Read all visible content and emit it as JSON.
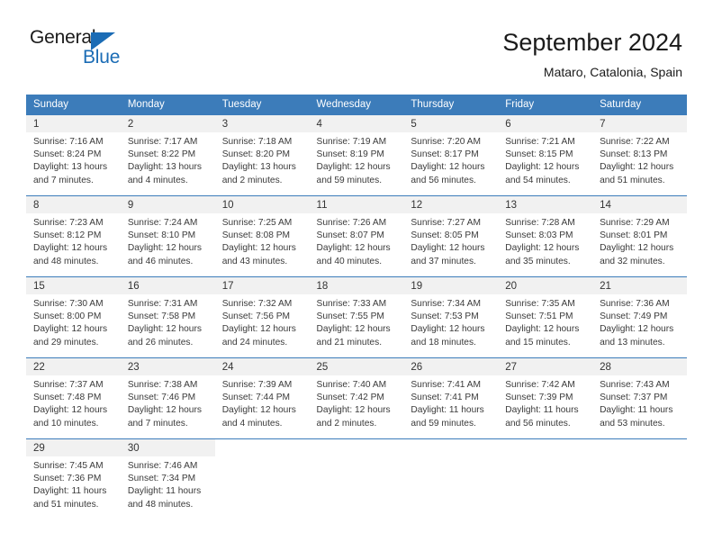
{
  "brand": {
    "name_top": "General",
    "name_bottom": "Blue",
    "accent_color": "#1b6cb5",
    "triangle_icon": "brand-triangle-icon"
  },
  "header": {
    "title": "September 2024",
    "subtitle": "Mataro, Catalonia, Spain"
  },
  "calendar": {
    "header_bg": "#3c7cba",
    "header_text_color": "#ffffff",
    "daynum_bg": "#f1f1f1",
    "weekday_headers": [
      "Sunday",
      "Monday",
      "Tuesday",
      "Wednesday",
      "Thursday",
      "Friday",
      "Saturday"
    ],
    "weeks": [
      [
        {
          "day": "1",
          "sunrise": "Sunrise: 7:16 AM",
          "sunset": "Sunset: 8:24 PM",
          "daylight_1": "Daylight: 13 hours",
          "daylight_2": "and 7 minutes."
        },
        {
          "day": "2",
          "sunrise": "Sunrise: 7:17 AM",
          "sunset": "Sunset: 8:22 PM",
          "daylight_1": "Daylight: 13 hours",
          "daylight_2": "and 4 minutes."
        },
        {
          "day": "3",
          "sunrise": "Sunrise: 7:18 AM",
          "sunset": "Sunset: 8:20 PM",
          "daylight_1": "Daylight: 13 hours",
          "daylight_2": "and 2 minutes."
        },
        {
          "day": "4",
          "sunrise": "Sunrise: 7:19 AM",
          "sunset": "Sunset: 8:19 PM",
          "daylight_1": "Daylight: 12 hours",
          "daylight_2": "and 59 minutes."
        },
        {
          "day": "5",
          "sunrise": "Sunrise: 7:20 AM",
          "sunset": "Sunset: 8:17 PM",
          "daylight_1": "Daylight: 12 hours",
          "daylight_2": "and 56 minutes."
        },
        {
          "day": "6",
          "sunrise": "Sunrise: 7:21 AM",
          "sunset": "Sunset: 8:15 PM",
          "daylight_1": "Daylight: 12 hours",
          "daylight_2": "and 54 minutes."
        },
        {
          "day": "7",
          "sunrise": "Sunrise: 7:22 AM",
          "sunset": "Sunset: 8:13 PM",
          "daylight_1": "Daylight: 12 hours",
          "daylight_2": "and 51 minutes."
        }
      ],
      [
        {
          "day": "8",
          "sunrise": "Sunrise: 7:23 AM",
          "sunset": "Sunset: 8:12 PM",
          "daylight_1": "Daylight: 12 hours",
          "daylight_2": "and 48 minutes."
        },
        {
          "day": "9",
          "sunrise": "Sunrise: 7:24 AM",
          "sunset": "Sunset: 8:10 PM",
          "daylight_1": "Daylight: 12 hours",
          "daylight_2": "and 46 minutes."
        },
        {
          "day": "10",
          "sunrise": "Sunrise: 7:25 AM",
          "sunset": "Sunset: 8:08 PM",
          "daylight_1": "Daylight: 12 hours",
          "daylight_2": "and 43 minutes."
        },
        {
          "day": "11",
          "sunrise": "Sunrise: 7:26 AM",
          "sunset": "Sunset: 8:07 PM",
          "daylight_1": "Daylight: 12 hours",
          "daylight_2": "and 40 minutes."
        },
        {
          "day": "12",
          "sunrise": "Sunrise: 7:27 AM",
          "sunset": "Sunset: 8:05 PM",
          "daylight_1": "Daylight: 12 hours",
          "daylight_2": "and 37 minutes."
        },
        {
          "day": "13",
          "sunrise": "Sunrise: 7:28 AM",
          "sunset": "Sunset: 8:03 PM",
          "daylight_1": "Daylight: 12 hours",
          "daylight_2": "and 35 minutes."
        },
        {
          "day": "14",
          "sunrise": "Sunrise: 7:29 AM",
          "sunset": "Sunset: 8:01 PM",
          "daylight_1": "Daylight: 12 hours",
          "daylight_2": "and 32 minutes."
        }
      ],
      [
        {
          "day": "15",
          "sunrise": "Sunrise: 7:30 AM",
          "sunset": "Sunset: 8:00 PM",
          "daylight_1": "Daylight: 12 hours",
          "daylight_2": "and 29 minutes."
        },
        {
          "day": "16",
          "sunrise": "Sunrise: 7:31 AM",
          "sunset": "Sunset: 7:58 PM",
          "daylight_1": "Daylight: 12 hours",
          "daylight_2": "and 26 minutes."
        },
        {
          "day": "17",
          "sunrise": "Sunrise: 7:32 AM",
          "sunset": "Sunset: 7:56 PM",
          "daylight_1": "Daylight: 12 hours",
          "daylight_2": "and 24 minutes."
        },
        {
          "day": "18",
          "sunrise": "Sunrise: 7:33 AM",
          "sunset": "Sunset: 7:55 PM",
          "daylight_1": "Daylight: 12 hours",
          "daylight_2": "and 21 minutes."
        },
        {
          "day": "19",
          "sunrise": "Sunrise: 7:34 AM",
          "sunset": "Sunset: 7:53 PM",
          "daylight_1": "Daylight: 12 hours",
          "daylight_2": "and 18 minutes."
        },
        {
          "day": "20",
          "sunrise": "Sunrise: 7:35 AM",
          "sunset": "Sunset: 7:51 PM",
          "daylight_1": "Daylight: 12 hours",
          "daylight_2": "and 15 minutes."
        },
        {
          "day": "21",
          "sunrise": "Sunrise: 7:36 AM",
          "sunset": "Sunset: 7:49 PM",
          "daylight_1": "Daylight: 12 hours",
          "daylight_2": "and 13 minutes."
        }
      ],
      [
        {
          "day": "22",
          "sunrise": "Sunrise: 7:37 AM",
          "sunset": "Sunset: 7:48 PM",
          "daylight_1": "Daylight: 12 hours",
          "daylight_2": "and 10 minutes."
        },
        {
          "day": "23",
          "sunrise": "Sunrise: 7:38 AM",
          "sunset": "Sunset: 7:46 PM",
          "daylight_1": "Daylight: 12 hours",
          "daylight_2": "and 7 minutes."
        },
        {
          "day": "24",
          "sunrise": "Sunrise: 7:39 AM",
          "sunset": "Sunset: 7:44 PM",
          "daylight_1": "Daylight: 12 hours",
          "daylight_2": "and 4 minutes."
        },
        {
          "day": "25",
          "sunrise": "Sunrise: 7:40 AM",
          "sunset": "Sunset: 7:42 PM",
          "daylight_1": "Daylight: 12 hours",
          "daylight_2": "and 2 minutes."
        },
        {
          "day": "26",
          "sunrise": "Sunrise: 7:41 AM",
          "sunset": "Sunset: 7:41 PM",
          "daylight_1": "Daylight: 11 hours",
          "daylight_2": "and 59 minutes."
        },
        {
          "day": "27",
          "sunrise": "Sunrise: 7:42 AM",
          "sunset": "Sunset: 7:39 PM",
          "daylight_1": "Daylight: 11 hours",
          "daylight_2": "and 56 minutes."
        },
        {
          "day": "28",
          "sunrise": "Sunrise: 7:43 AM",
          "sunset": "Sunset: 7:37 PM",
          "daylight_1": "Daylight: 11 hours",
          "daylight_2": "and 53 minutes."
        }
      ],
      [
        {
          "day": "29",
          "sunrise": "Sunrise: 7:45 AM",
          "sunset": "Sunset: 7:36 PM",
          "daylight_1": "Daylight: 11 hours",
          "daylight_2": "and 51 minutes."
        },
        {
          "day": "30",
          "sunrise": "Sunrise: 7:46 AM",
          "sunset": "Sunset: 7:34 PM",
          "daylight_1": "Daylight: 11 hours",
          "daylight_2": "and 48 minutes."
        },
        {
          "day": "",
          "sunrise": "",
          "sunset": "",
          "daylight_1": "",
          "daylight_2": ""
        },
        {
          "day": "",
          "sunrise": "",
          "sunset": "",
          "daylight_1": "",
          "daylight_2": ""
        },
        {
          "day": "",
          "sunrise": "",
          "sunset": "",
          "daylight_1": "",
          "daylight_2": ""
        },
        {
          "day": "",
          "sunrise": "",
          "sunset": "",
          "daylight_1": "",
          "daylight_2": ""
        },
        {
          "day": "",
          "sunrise": "",
          "sunset": "",
          "daylight_1": "",
          "daylight_2": ""
        }
      ]
    ]
  }
}
